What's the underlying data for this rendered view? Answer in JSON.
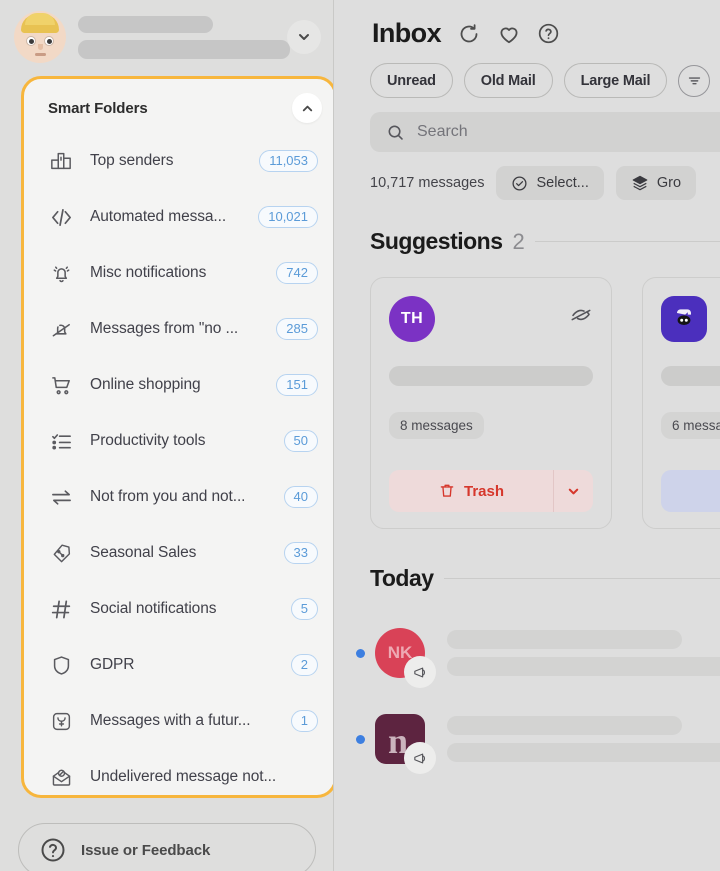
{
  "sidebar": {
    "account": {
      "avatar_name": "user-memoji-avatar",
      "chevron_icon": "chevron-down-icon"
    },
    "smart_folders": {
      "title": "Smart Folders",
      "collapse_icon": "chevron-up-icon",
      "items": [
        {
          "label": "Top senders",
          "count": "11,053",
          "icon": "podium-icon"
        },
        {
          "label": "Automated messa...",
          "count": "10,021",
          "icon": "code-brackets-icon"
        },
        {
          "label": "Misc notifications",
          "count": "742",
          "icon": "bell-ringing-icon"
        },
        {
          "label": "Messages from \"no ...",
          "count": "285",
          "icon": "bell-slash-icon"
        },
        {
          "label": "Online shopping",
          "count": "151",
          "icon": "shopping-cart-icon"
        },
        {
          "label": "Productivity tools",
          "count": "50",
          "icon": "checklist-icon"
        },
        {
          "label": "Not from you and not...",
          "count": "40",
          "icon": "arrows-exchange-icon"
        },
        {
          "label": "Seasonal Sales",
          "count": "33",
          "icon": "discount-tag-icon"
        },
        {
          "label": "Social notifications",
          "count": "5",
          "icon": "hashtag-icon"
        },
        {
          "label": "GDPR",
          "count": "2",
          "icon": "shield-icon"
        },
        {
          "label": "Messages with a futur...",
          "count": "1",
          "icon": "future-date-icon"
        },
        {
          "label": "Undelivered message not...",
          "count": "",
          "icon": "undelivered-mail-icon"
        }
      ]
    },
    "feedback": {
      "label": "Issue or Feedback",
      "icon": "question-circle-icon"
    },
    "accent_color": "#f7b63d"
  },
  "main": {
    "header": {
      "title": "Inbox",
      "icons": [
        "refresh-icon",
        "heart-icon",
        "help-circle-icon"
      ]
    },
    "filters": {
      "chips": [
        "Unread",
        "Old Mail",
        "Large Mail"
      ],
      "filter_icon": "filter-lines-icon"
    },
    "search": {
      "placeholder": "Search",
      "icon": "search-icon"
    },
    "meta": {
      "message_count": "10,717 messages",
      "select_label": "Select...",
      "select_icon": "check-circle-icon",
      "group_label": "Gro",
      "group_icon": "layers-icon"
    },
    "suggestions": {
      "title": "Suggestions",
      "count": "2",
      "cards": [
        {
          "avatar_initials": "TH",
          "avatar_color": "#7b32c4",
          "avatar_shape": "circle",
          "hide_icon": "eye-slash-icon",
          "message_count": "8 messages",
          "action_label": "Trash",
          "action_icon": "trash-icon",
          "action_color": "#d6372c",
          "dropdown_icon": "chevron-down-icon"
        },
        {
          "avatar_initials": "",
          "avatar_color": "#4b2fbd",
          "avatar_shape": "rounded",
          "hide_icon": "",
          "message_count": "6 messa",
          "action_label": "",
          "action_icon": "archive-icon",
          "action_color": "#2c59d6",
          "dropdown_icon": ""
        }
      ]
    },
    "today": {
      "title": "Today",
      "rows": [
        {
          "initials": "NK",
          "color": "#d94257",
          "shape": "circle",
          "badge_icon": "megaphone-icon",
          "unread": true
        },
        {
          "initials": "",
          "color": "#5d2440",
          "shape": "rounded",
          "badge_icon": "megaphone-icon",
          "unread": true
        }
      ]
    },
    "accent_unread": "#3d7fe0"
  }
}
